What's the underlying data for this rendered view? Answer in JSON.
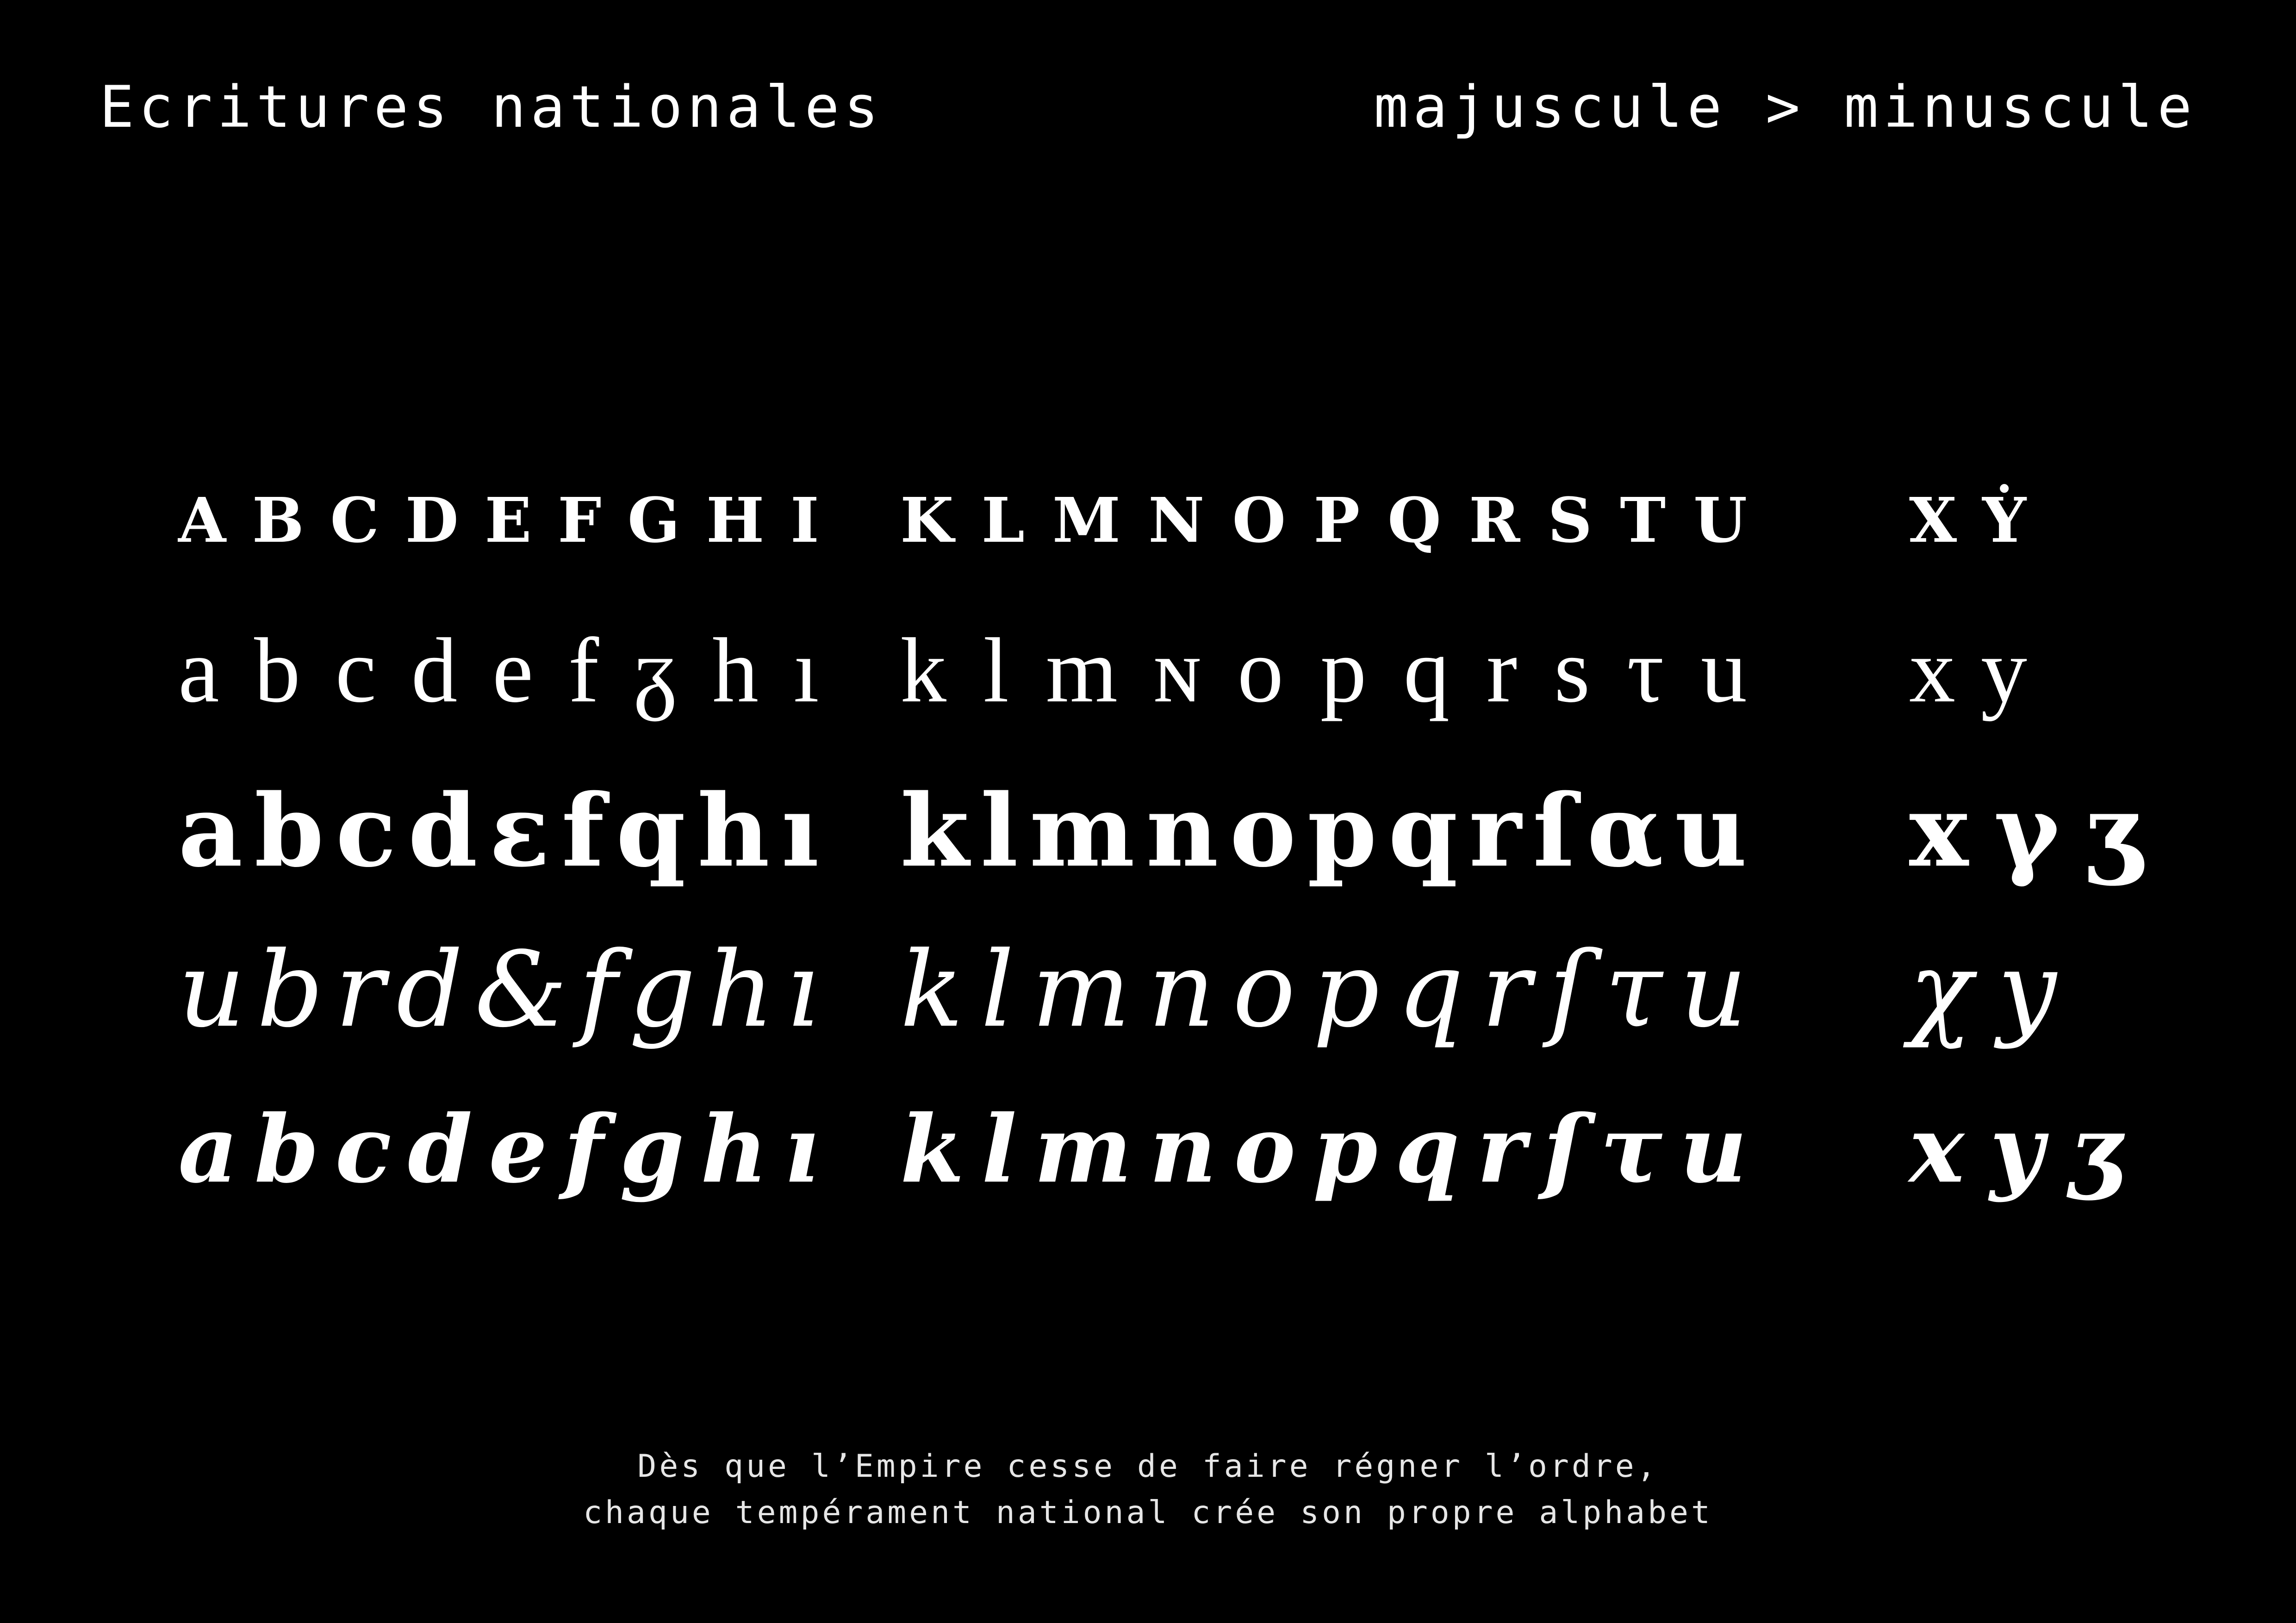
{
  "header": {
    "title": "Ecritures nationales",
    "subtitle": "majuscule > minuscule"
  },
  "scripts": [
    {
      "group_a": [
        "a",
        "b",
        "c",
        "d",
        "e",
        "f",
        "g",
        "h",
        "i"
      ],
      "group_b": [
        "k",
        "l",
        "m",
        "n",
        "o",
        "p",
        "q",
        "r",
        "s",
        "t",
        "u"
      ],
      "group_c": [
        "x",
        "ẏ"
      ]
    },
    {
      "group_a": [
        "a",
        "b",
        "c",
        "d",
        "e",
        "f",
        "ᵹ",
        "h",
        "ı"
      ],
      "group_b": [
        "k",
        "l",
        "m",
        "ɴ",
        "o",
        "p",
        "q",
        "r",
        "s",
        "τ",
        "u"
      ],
      "group_c": [
        "x",
        "y"
      ]
    },
    {
      "group_a": [
        "a",
        "b",
        "c",
        "d",
        "ε",
        "f",
        "q",
        "h",
        "ı"
      ],
      "group_b": [
        "k",
        "l",
        "m",
        "n",
        "o",
        "p",
        "q",
        "r",
        "ſ",
        "α",
        "u"
      ],
      "group_c": [
        "x",
        "γ",
        "ʒ"
      ]
    },
    {
      "group_a": [
        "u",
        "b",
        "r",
        "d",
        "&",
        "f",
        "g",
        "h",
        "ı"
      ],
      "group_b": [
        "k",
        "l",
        "m",
        "n",
        "o",
        "p",
        "q",
        "r",
        "ſ",
        "τ",
        "u"
      ],
      "group_c": [
        "χ",
        "y"
      ]
    },
    {
      "group_a": [
        "a",
        "b",
        "c",
        "d",
        "e",
        "f",
        "g",
        "h",
        "ı"
      ],
      "group_b": [
        "k",
        "l",
        "m",
        "n",
        "o",
        "p",
        "q",
        "r",
        "ſ",
        "τ",
        "u"
      ],
      "group_c": [
        "x",
        "y",
        "ʒ"
      ]
    }
  ],
  "caption": {
    "line1": "Dès que l’Empire cesse de faire régner l’ordre,",
    "line2": "chaque tempérament national crée son propre alphabet"
  }
}
